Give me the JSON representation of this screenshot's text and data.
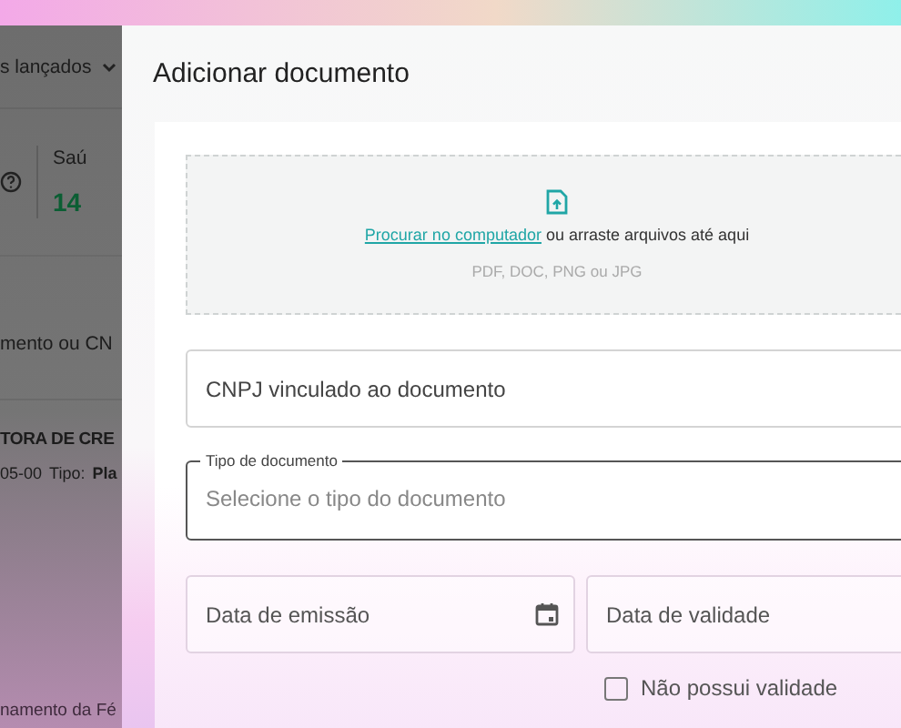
{
  "background_page": {
    "filter_label": "s lançados",
    "metric_label": "Saú",
    "metric_value": "14",
    "search_placeholder": "mento ou CN",
    "row_title": "TORA DE CRE",
    "row_code": "05-00",
    "row_type_label": "Tipo:",
    "row_type_value": "Pla",
    "footer_text": "namento da Fé"
  },
  "drawer": {
    "title": "Adicionar documento",
    "upload": {
      "link": "Procurar no computador",
      "text": "ou arraste arquivos até aqui",
      "formats": "PDF, DOC, PNG ou JPG"
    },
    "fields": [
      {
        "kind": "text",
        "placeholder": "CNPJ vinculado ao documento"
      },
      {
        "kind": "select",
        "label": "Tipo de documento",
        "placeholder": "Selecione o tipo do documento"
      }
    ],
    "dates": [
      {
        "kind": "date",
        "placeholder": "Data de emissão"
      },
      {
        "kind": "text",
        "placeholder": "Data de validade"
      }
    ],
    "no_validity": {
      "label": "Não possui validade",
      "checked": false
    }
  }
}
